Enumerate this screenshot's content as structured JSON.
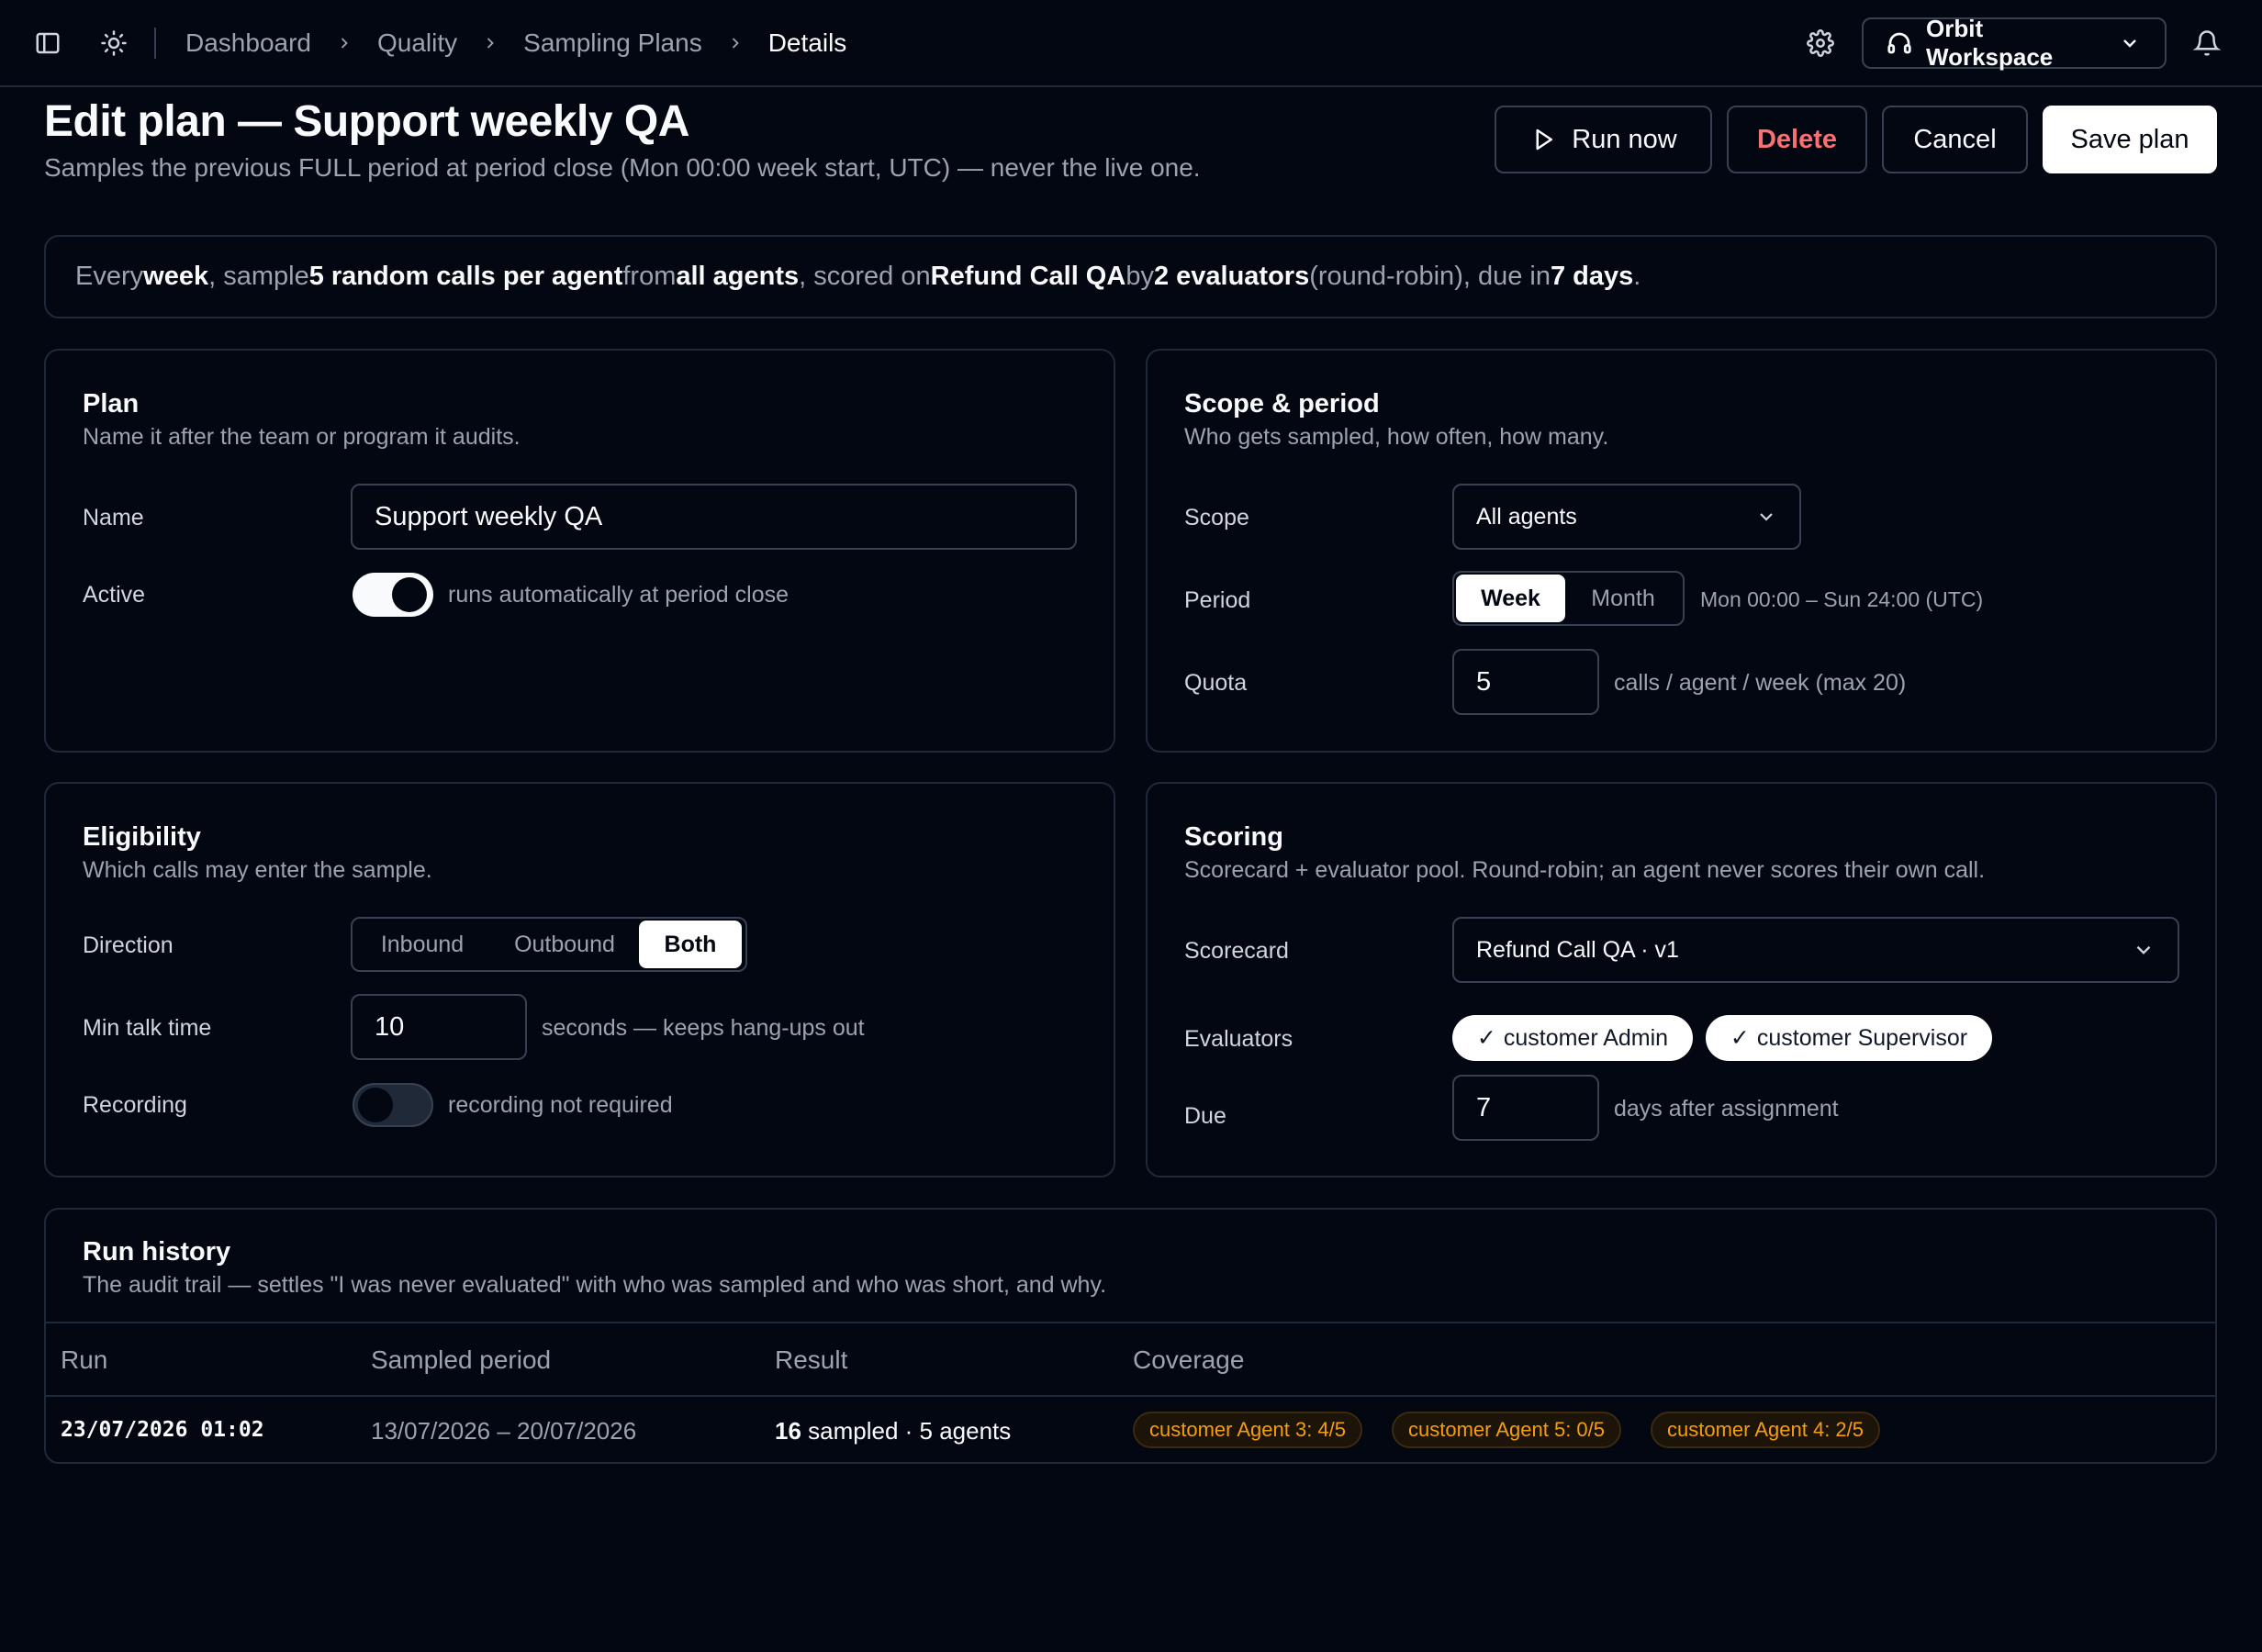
{
  "topbar": {
    "breadcrumbs": [
      "Dashboard",
      "Quality",
      "Sampling Plans",
      "Details"
    ],
    "workspace": "Orbit Workspace"
  },
  "header": {
    "title": "Edit plan — Support weekly QA",
    "subtitle": "Samples the previous FULL period at period close (Mon 00:00 week start, UTC) — never the live one.",
    "buttons": {
      "run_now": "Run now",
      "delete": "Delete",
      "cancel": "Cancel",
      "save": "Save plan"
    }
  },
  "summary": {
    "t1": "Every ",
    "b1": "week",
    "t2": ", sample ",
    "b2": "5 random calls per agent",
    "t3": " from ",
    "b3": "all agents",
    "t4": ", scored on ",
    "b4": "Refund Call QA",
    "t5": " by ",
    "b5": "2 evaluators",
    "t6": " (round-robin), due in ",
    "b6": "7 days",
    "t7": "."
  },
  "plan": {
    "title": "Plan",
    "description": "Name it after the team or program it audits.",
    "name_label": "Name",
    "name_value": "Support weekly QA",
    "active_label": "Active",
    "active_on": true,
    "active_hint": "runs automatically at period close"
  },
  "scope": {
    "title": "Scope & period",
    "description": "Who gets sampled, how often, how many.",
    "scope_label": "Scope",
    "scope_value": "All agents",
    "period_label": "Period",
    "period_options": [
      "Week",
      "Month"
    ],
    "period_selected": "Week",
    "period_hint": "Mon 00:00 – Sun 24:00 (UTC)",
    "quota_label": "Quota",
    "quota_value": "5",
    "quota_hint": "calls / agent / week (max 20)"
  },
  "eligibility": {
    "title": "Eligibility",
    "description": "Which calls may enter the sample.",
    "direction_label": "Direction",
    "direction_options": [
      "Inbound",
      "Outbound",
      "Both"
    ],
    "direction_selected": "Both",
    "min_talk_label": "Min talk time",
    "min_talk_value": "10",
    "min_talk_hint": "seconds — keeps hang-ups out",
    "recording_label": "Recording",
    "recording_on": false,
    "recording_hint": "recording not required"
  },
  "scoring": {
    "title": "Scoring",
    "description": "Scorecard + evaluator pool. Round-robin; an agent never scores their own call.",
    "scorecard_label": "Scorecard",
    "scorecard_value": "Refund Call QA · v1",
    "evaluators_label": "Evaluators",
    "evaluators": [
      "customer Admin",
      "customer Supervisor"
    ],
    "check_glyph": "✓",
    "due_label": "Due",
    "due_value": "7",
    "due_hint": "days after assignment"
  },
  "history": {
    "title": "Run history",
    "description": "The audit trail — settles \"I was never evaluated\" with who was sampled and who was short, and why.",
    "columns": [
      "Run",
      "Sampled period",
      "Result",
      "Coverage"
    ],
    "rows": [
      {
        "run": "23/07/2026 01:02",
        "period": "13/07/2026 – 20/07/2026",
        "result_count": "16",
        "result_rest": " sampled · 5 agents",
        "coverage": [
          "customer Agent 3: 4/5",
          "customer Agent 5: 0/5",
          "customer Agent 4: 2/5"
        ]
      }
    ]
  },
  "colors": {
    "background": "#030712",
    "border": "#1f2937",
    "danger": "#f87171",
    "warning": "#f59e0b",
    "muted": "#9ca3af"
  },
  "icons": [
    "sidebar-toggle-icon",
    "sun-icon",
    "chevron-right-icon",
    "gear-icon",
    "headset-icon",
    "chevron-down-icon",
    "bell-icon",
    "play-icon"
  ]
}
